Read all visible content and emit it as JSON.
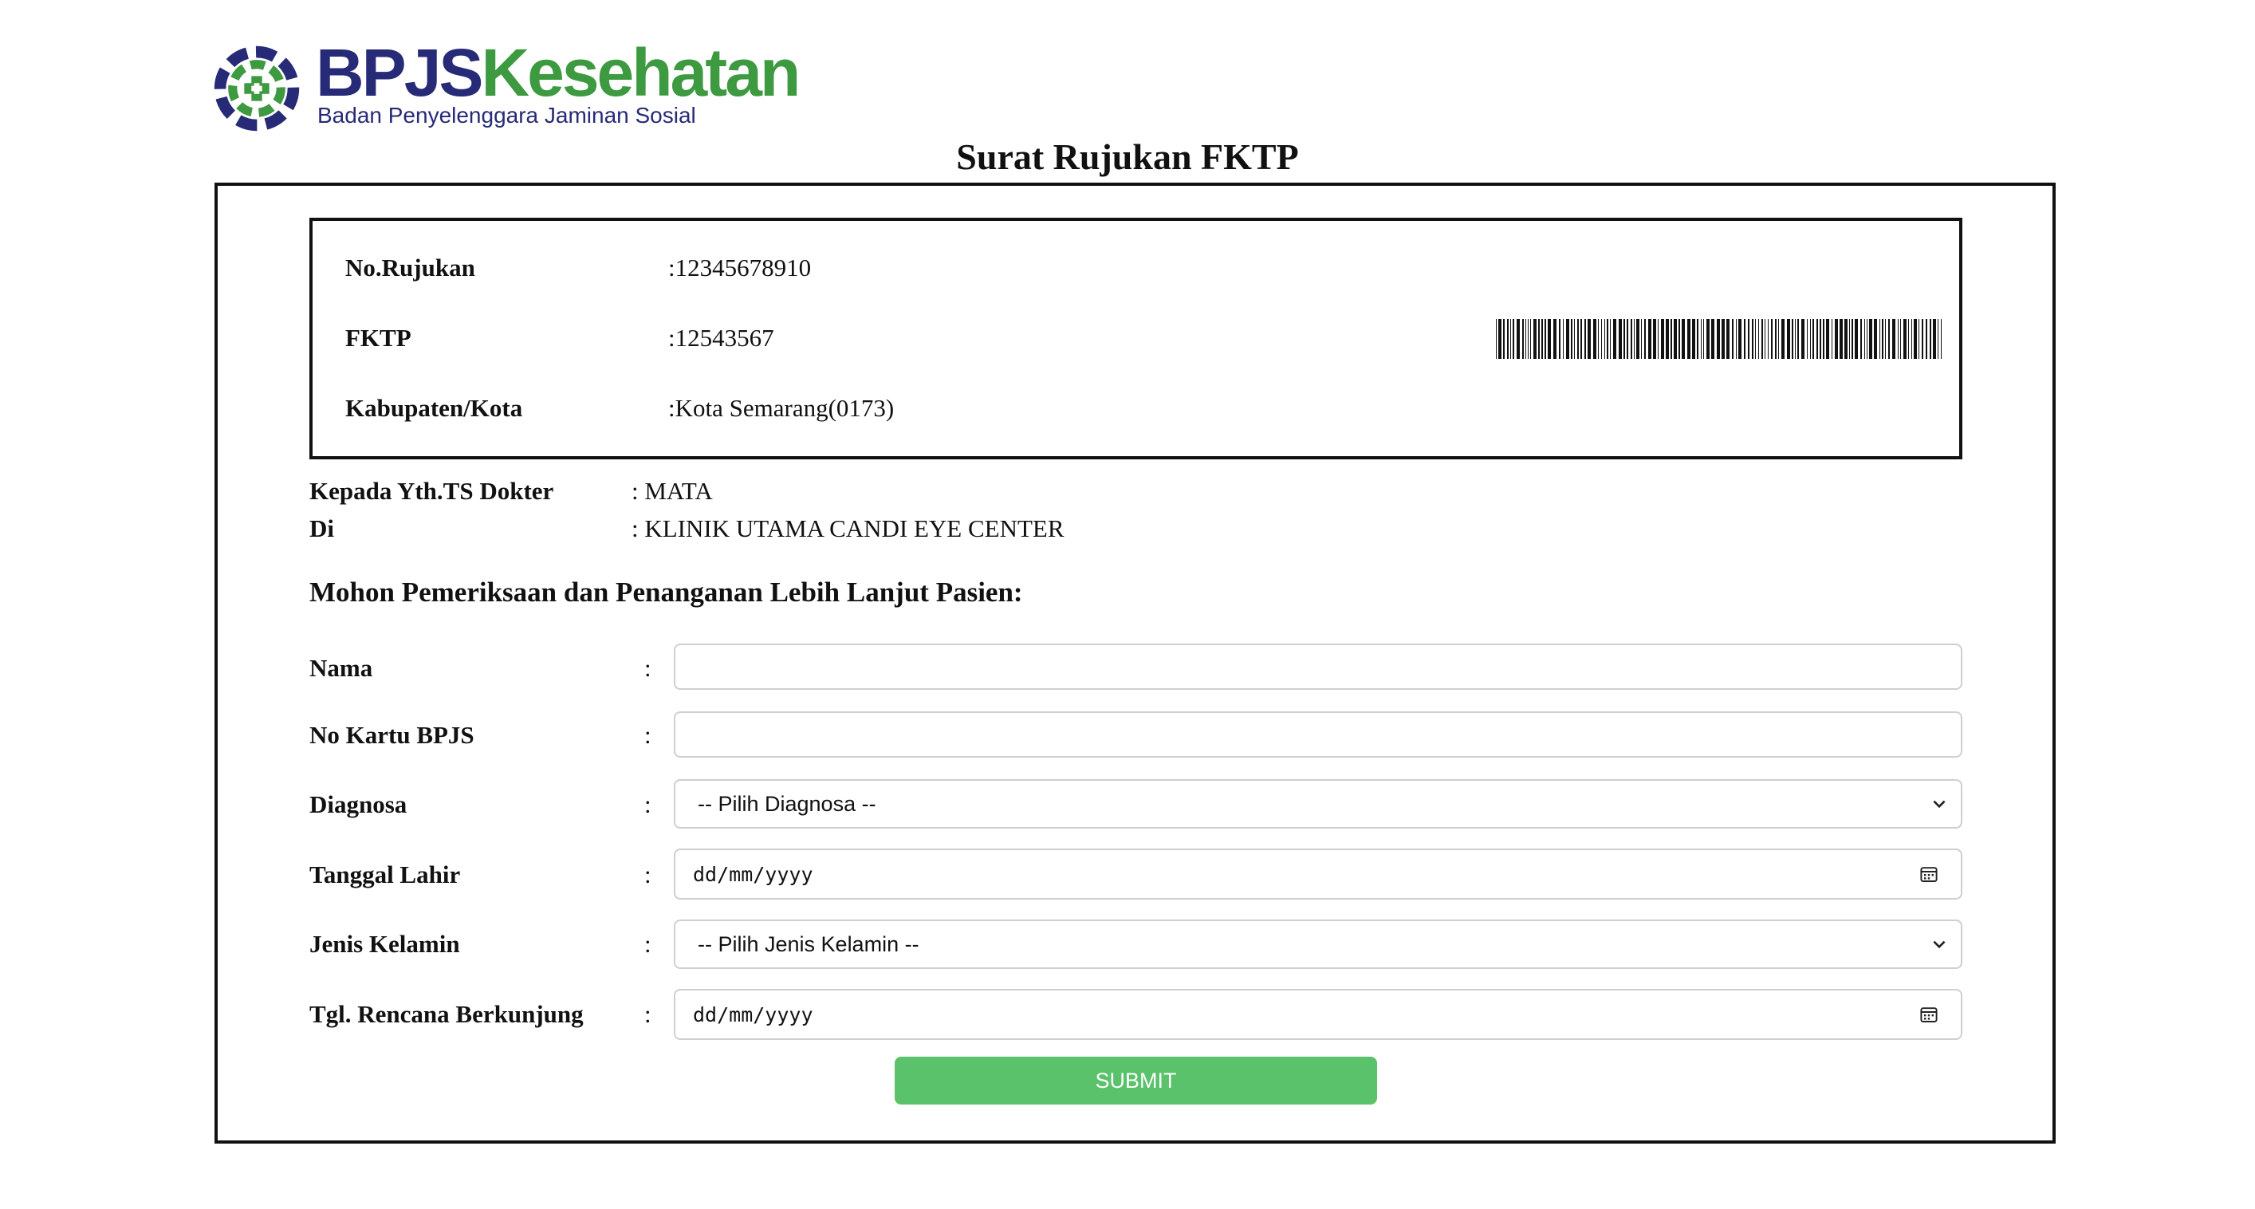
{
  "logo": {
    "brand_part1": "BPJS",
    "brand_part2": "Kesehatan",
    "subtitle": "Badan Penyelenggara Jaminan Sosial",
    "colors": {
      "navy": "#272a76",
      "green": "#3e9a40"
    }
  },
  "page_title": "Surat Rujukan FKTP",
  "referral": {
    "no_rujukan": {
      "label": "No.Rujukan",
      "value": ":12345678910"
    },
    "fktp": {
      "label": "FKTP",
      "value": ":12543567"
    },
    "kabupaten": {
      "label": "Kabupaten/Kota",
      "value": ":Kota Semarang(0173)"
    },
    "barcode_icon": "barcode"
  },
  "destination": {
    "doctor": {
      "label": "Kepada Yth.TS Dokter",
      "value": ": MATA"
    },
    "place": {
      "label": "Di",
      "value": ": KLINIK UTAMA CANDI EYE CENTER"
    }
  },
  "request_heading": "Mohon Pemeriksaan dan Penanganan Lebih Lanjut Pasien:",
  "form": {
    "colon": ":",
    "nama": {
      "label": "Nama",
      "value": ""
    },
    "no_kartu": {
      "label": "No Kartu BPJS",
      "value": ""
    },
    "diagnosa": {
      "label": "Diagnosa",
      "selected": "-- Pilih Diagnosa --"
    },
    "tanggal_lahir": {
      "label": "Tanggal Lahir",
      "placeholder": "dd/mm/yyyy"
    },
    "jenis_kelamin": {
      "label": "Jenis Kelamin",
      "selected": "-- Pilih Jenis Kelamin --"
    },
    "tgl_rencana": {
      "label": "Tgl. Rencana Berkunjung",
      "placeholder": "dd/mm/yyyy"
    },
    "submit_label": "SUBMIT",
    "submit_color": "#5ac26b"
  }
}
